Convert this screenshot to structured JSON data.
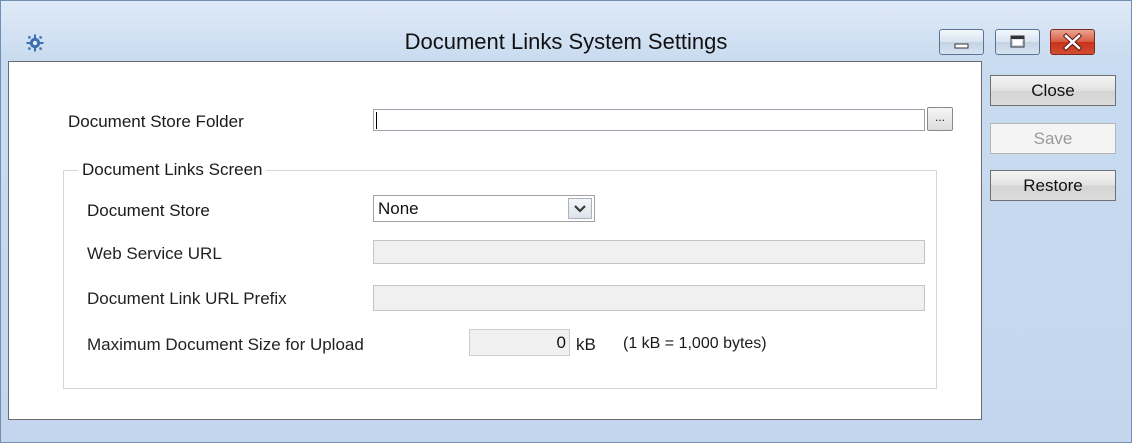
{
  "window": {
    "title": "Document Links System Settings",
    "icon": "gear-icon",
    "controls": {
      "minimize": "minimize-icon",
      "maximize": "maximize-icon",
      "close": "close-icon"
    },
    "close_color": "#d9593f"
  },
  "form": {
    "store_folder_label": "Document Store Folder",
    "store_folder_value": "",
    "browse_label": "...",
    "group_title": "Document Links Screen",
    "document_store_label": "Document Store",
    "document_store_value": "None",
    "web_service_url_label": "Web Service URL",
    "web_service_url_value": "",
    "link_prefix_label": "Document Link URL Prefix",
    "link_prefix_value": "",
    "max_size_label": "Maximum Document Size for Upload",
    "max_size_value": "0",
    "max_size_unit": "kB",
    "max_size_note": "(1 kB = 1,000 bytes)"
  },
  "buttons": {
    "close_label": "Close",
    "save_label": "Save",
    "restore_label": "Restore"
  }
}
